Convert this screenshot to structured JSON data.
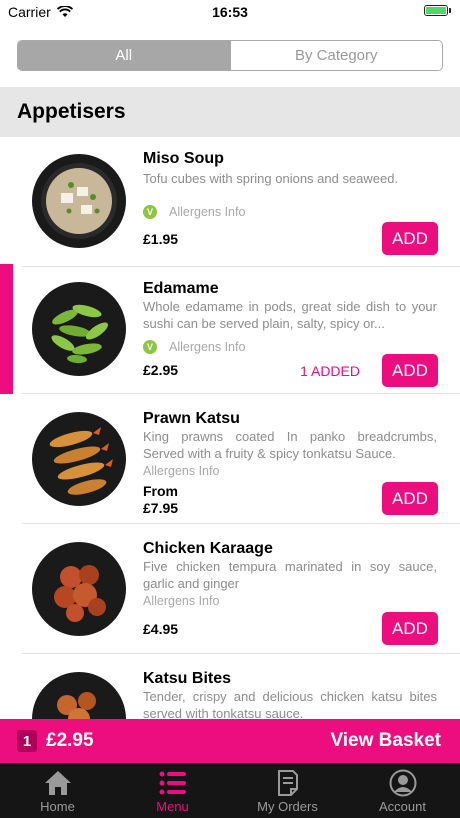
{
  "status_bar": {
    "carrier": "Carrier",
    "time": "16:53"
  },
  "segmented": {
    "all_label": "All",
    "by_category_label": "By Category"
  },
  "section": {
    "title": "Appetisers"
  },
  "items": [
    {
      "name": "Miso Soup",
      "description": "Tofu cubes with spring onions and seaweed.",
      "allergens_label": "Allergens Info",
      "price": "£1.95",
      "add_label": "ADD",
      "vegetarian": true
    },
    {
      "name": "Edamame",
      "description": "Whole edamame in pods, great side dish to your sushi can be served plain, salty, spicy or...",
      "allergens_label": "Allergens Info",
      "price": "£2.95",
      "added_label": "1 ADDED",
      "add_label": "ADD",
      "vegetarian": true
    },
    {
      "name": "Prawn Katsu",
      "description": "King prawns coated In panko breadcrumbs, Served with a fruity & spicy tonkatsu Sauce.",
      "allergens_label": "Allergens Info",
      "price_from": "From",
      "price": "£7.95",
      "add_label": "ADD",
      "vegetarian": false
    },
    {
      "name": "Chicken Karaage",
      "description": "Five chicken tempura marinated in soy sauce, garlic and ginger",
      "allergens_label": "Allergens Info",
      "price": "£4.95",
      "add_label": "ADD",
      "vegetarian": false
    },
    {
      "name": "Katsu Bites",
      "description": "Tender, crispy and delicious chicken katsu bites served with tonkatsu sauce.",
      "vegetarian": false
    }
  ],
  "veg_badge": "V",
  "basket": {
    "count": "1",
    "total": "£2.95",
    "view_label": "View Basket"
  },
  "tabs": [
    {
      "label": "Home",
      "icon": "home-icon"
    },
    {
      "label": "Menu",
      "icon": "menu-icon"
    },
    {
      "label": "My Orders",
      "icon": "orders-icon"
    },
    {
      "label": "Account",
      "icon": "account-icon"
    }
  ],
  "colors": {
    "accent": "#ec0d7e",
    "tabbar": "#151515",
    "section_bg": "#e6e6e6",
    "veg": "#8dc63f"
  }
}
